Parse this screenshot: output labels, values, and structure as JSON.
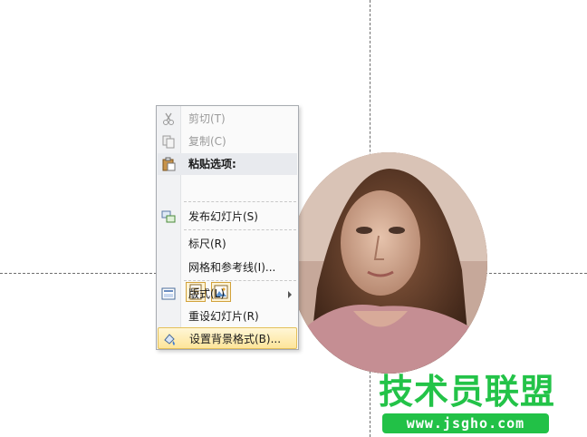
{
  "menu": {
    "items": [
      {
        "label": "剪切(T)",
        "icon": "scissors-icon",
        "enabled": false
      },
      {
        "label": "复制(C)",
        "icon": "copy-icon",
        "enabled": false
      },
      {
        "label": "粘贴选项:",
        "icon": "paste-clipboard-icon",
        "enabled": true
      },
      {
        "label": "发布幻灯片(S)",
        "icon": "publish-slides-icon",
        "enabled": true
      },
      {
        "label": "标尺(R)",
        "icon": "",
        "enabled": true
      },
      {
        "label": "网格和参考线(I)...",
        "icon": "",
        "enabled": true
      },
      {
        "label": "版式(L)",
        "icon": "layout-icon",
        "enabled": true,
        "submenu": true
      },
      {
        "label": "重设幻灯片(R)",
        "icon": "",
        "enabled": true
      },
      {
        "label": "设置背景格式(B)...",
        "icon": "format-background-icon",
        "enabled": true,
        "highlighted": true
      }
    ],
    "paste_options": [
      "paste-keep-text-icon",
      "paste-picture-icon"
    ]
  },
  "watermark": {
    "title": "技术员联盟",
    "url": "www.jsgho.com",
    "color": "#23c348"
  },
  "colors": {
    "highlight": "#fde59a",
    "guides": "#6f6f6f"
  }
}
